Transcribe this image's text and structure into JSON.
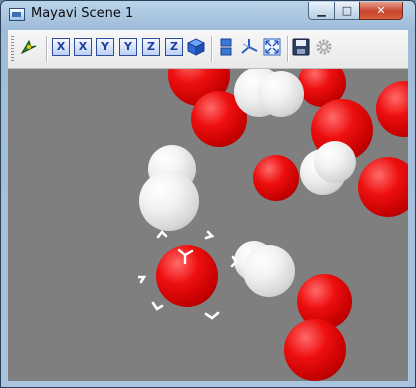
{
  "window": {
    "title": "Mayavi Scene 1"
  },
  "title_buttons": {
    "minimize": "▁",
    "maximize": "□",
    "close": "✕"
  },
  "toolbar": {
    "buttons": [
      {
        "name": "mayavi-icon",
        "label": ""
      },
      {
        "name": "view-x-minus",
        "label": "X"
      },
      {
        "name": "view-x-plus",
        "label": "X"
      },
      {
        "name": "view-y-minus",
        "label": "Y"
      },
      {
        "name": "view-y-plus",
        "label": "Y"
      },
      {
        "name": "view-z-minus",
        "label": "Z"
      },
      {
        "name": "view-z-plus",
        "label": "Z"
      },
      {
        "name": "isometric-view",
        "label": ""
      },
      {
        "name": "parallel-projection",
        "label": ""
      },
      {
        "name": "axes-indicator",
        "label": ""
      },
      {
        "name": "full-screen",
        "label": ""
      },
      {
        "name": "save-scene",
        "label": ""
      },
      {
        "name": "configure-scene",
        "label": ""
      }
    ]
  },
  "colors": {
    "red_atom": "#e01010",
    "white_atom": "#eeeeee",
    "background": "#7f7f7f"
  }
}
